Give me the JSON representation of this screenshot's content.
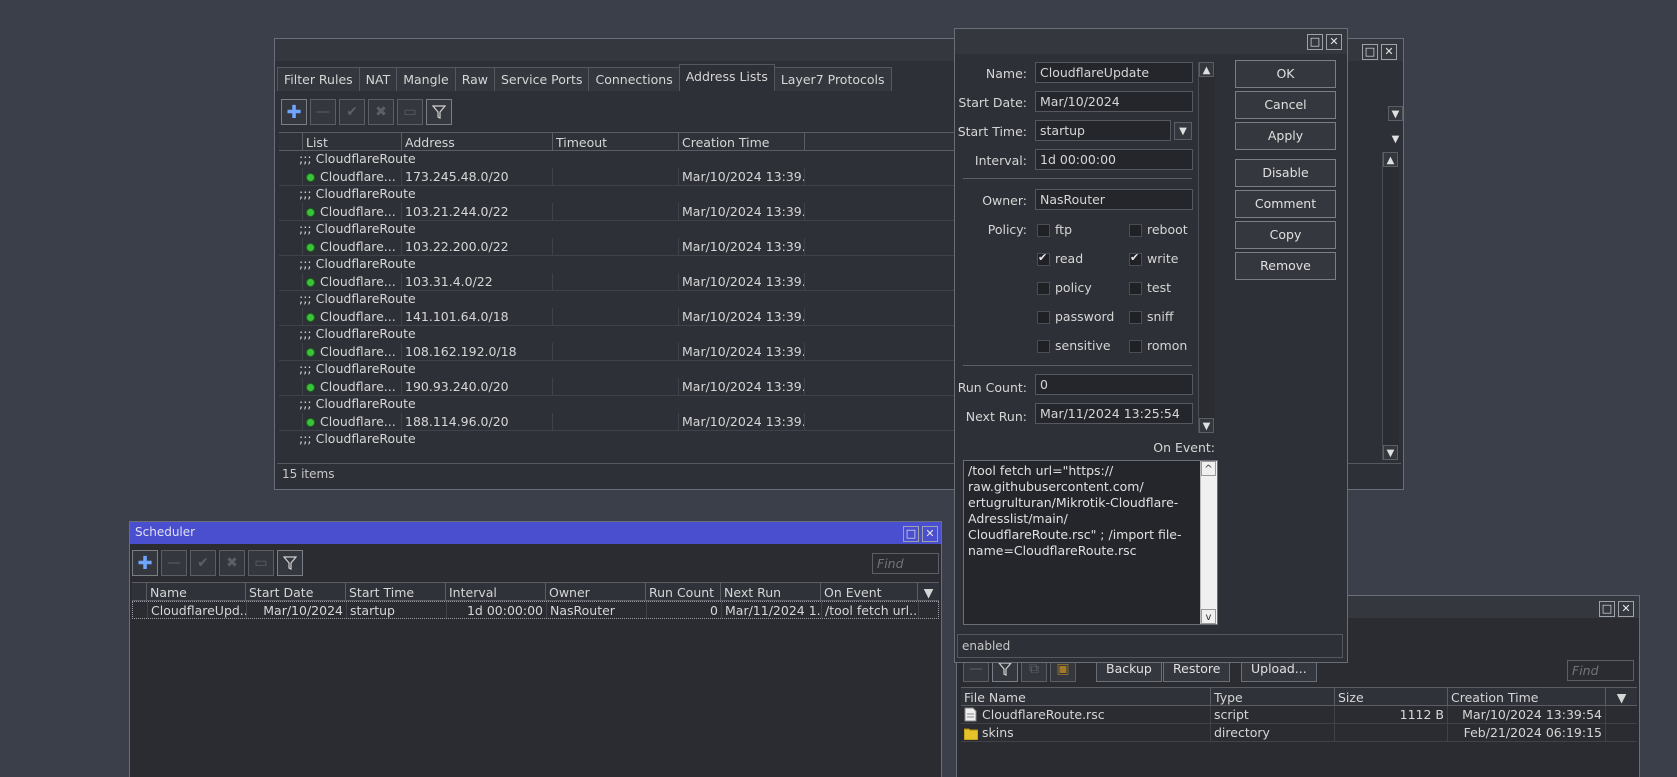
{
  "firewall": {
    "tabs": [
      "Filter Rules",
      "NAT",
      "Mangle",
      "Raw",
      "Service Ports",
      "Connections",
      "Address Lists",
      "Layer7 Protocols"
    ],
    "columns": [
      "List",
      "Address",
      "Timeout",
      "Creation Time"
    ],
    "comment": ";;; CloudflareRoute",
    "rows": [
      {
        "list": "Cloudflare...",
        "address": "173.245.48.0/20",
        "timeout": "",
        "created": "Mar/10/2024 13:39.."
      },
      {
        "list": "Cloudflare...",
        "address": "103.21.244.0/22",
        "timeout": "",
        "created": "Mar/10/2024 13:39.."
      },
      {
        "list": "Cloudflare...",
        "address": "103.22.200.0/22",
        "timeout": "",
        "created": "Mar/10/2024 13:39.."
      },
      {
        "list": "Cloudflare...",
        "address": "103.31.4.0/22",
        "timeout": "",
        "created": "Mar/10/2024 13:39.."
      },
      {
        "list": "Cloudflare...",
        "address": "141.101.64.0/18",
        "timeout": "",
        "created": "Mar/10/2024 13:39.."
      },
      {
        "list": "Cloudflare...",
        "address": "108.162.192.0/18",
        "timeout": "",
        "created": "Mar/10/2024 13:39.."
      },
      {
        "list": "Cloudflare...",
        "address": "190.93.240.0/20",
        "timeout": "",
        "created": "Mar/10/2024 13:39.."
      },
      {
        "list": "Cloudflare...",
        "address": "188.114.96.0/20",
        "timeout": "",
        "created": "Mar/10/2024 13:39.."
      }
    ],
    "status": "15 items"
  },
  "dialog": {
    "labels": {
      "name": "Name:",
      "start_date": "Start Date:",
      "start_time": "Start Time:",
      "interval": "Interval:",
      "owner": "Owner:",
      "policy": "Policy:",
      "run_count": "Run Count:",
      "next_run": "Next Run:",
      "on_event": "On Event:"
    },
    "name": "CloudflareUpdate",
    "start_date": "Mar/10/2024",
    "start_time": "startup",
    "interval": "1d 00:00:00",
    "owner": "NasRouter",
    "policies": {
      "ftp": "ftp",
      "reboot": "reboot",
      "read": "read",
      "write": "write",
      "policy": "policy",
      "test": "test",
      "password": "password",
      "sniff": "sniff",
      "sensitive": "sensitive",
      "romon": "romon"
    },
    "run_count": "0",
    "next_run": "Mar/11/2024 13:25:54",
    "on_event": "/tool fetch url=\"https://\nraw.githubusercontent.com/\nertugrulturan/Mikrotik-Cloudflare-\nAdresslist/main/\nCloudflareRoute.rsc\" ; /import file-\nname=CloudflareRoute.rsc",
    "buttons": [
      "OK",
      "Cancel",
      "Apply",
      "Disable",
      "Comment",
      "Copy",
      "Remove"
    ],
    "status": "enabled"
  },
  "scheduler": {
    "title": "Scheduler",
    "find_placeholder": "Find",
    "columns": [
      "Name",
      "Start Date",
      "Start Time",
      "Interval",
      "Owner",
      "Run Count",
      "Next Run",
      "On Event"
    ],
    "row": {
      "name": "CloudflareUpd...",
      "start_date": "Mar/10/2024",
      "start_time": "startup",
      "interval": "1d 00:00:00",
      "owner": "NasRouter",
      "run_count": "0",
      "next_run": "Mar/11/2024 1...",
      "on_event": "/tool fetch url..."
    }
  },
  "files": {
    "buttons": [
      "Backup",
      "Restore",
      "Upload..."
    ],
    "find_placeholder": "Find",
    "columns": [
      "File Name",
      "Type",
      "Size",
      "Creation Time"
    ],
    "rows": [
      {
        "name": "CloudflareRoute.rsc",
        "type": "script",
        "size": "1112 B",
        "created": "Mar/10/2024 13:39:54",
        "icon": "script-file-icon"
      },
      {
        "name": "skins",
        "type": "directory",
        "size": "",
        "created": "Feb/21/2024 06:19:15",
        "icon": "folder-icon"
      }
    ]
  }
}
